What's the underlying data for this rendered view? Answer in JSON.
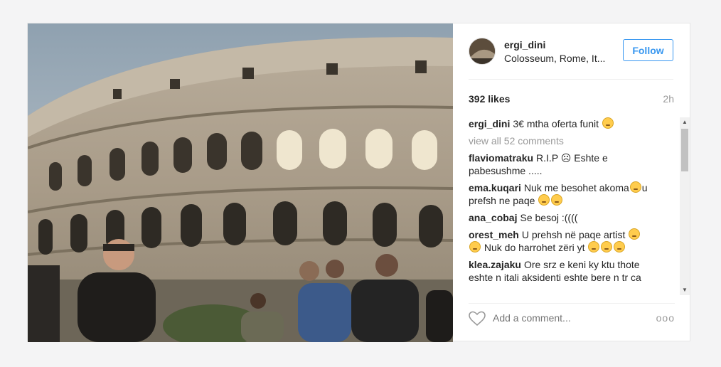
{
  "post": {
    "username": "ergi_dini",
    "location": "Colosseum, Rome, It...",
    "follow_label": "Follow",
    "likes": "392 likes",
    "time": "2h",
    "caption": {
      "author": "ergi_dini",
      "text": "3€ mtha oferta funit"
    },
    "view_all": "view all 52 comments",
    "comments": [
      {
        "author": "flaviomatraku",
        "text": "R.I.P ☹ Eshte e pabesushme ....."
      },
      {
        "author": "ema.kuqari",
        "text": "Nuk me besohet akoma",
        "text2": "u prefsh ne paqe"
      },
      {
        "author": "ana_cobaj",
        "text": "Se besoj :(((("
      },
      {
        "author": "orest_meh",
        "text": "U prehsh në paqe artist",
        "text2": "Nuk do harrohet zëri yt"
      },
      {
        "author": "klea.zajaku",
        "text": "Ore srz e keni ky ktu thote eshte n itali aksidenti eshte bere n tr ca"
      }
    ],
    "add_comment_placeholder": "Add a comment...",
    "more_label": "ooo"
  },
  "colors": {
    "accent": "#3897f0",
    "muted": "#999999",
    "text": "#262626"
  },
  "icons": [
    "heart-icon",
    "more-options-icon"
  ]
}
